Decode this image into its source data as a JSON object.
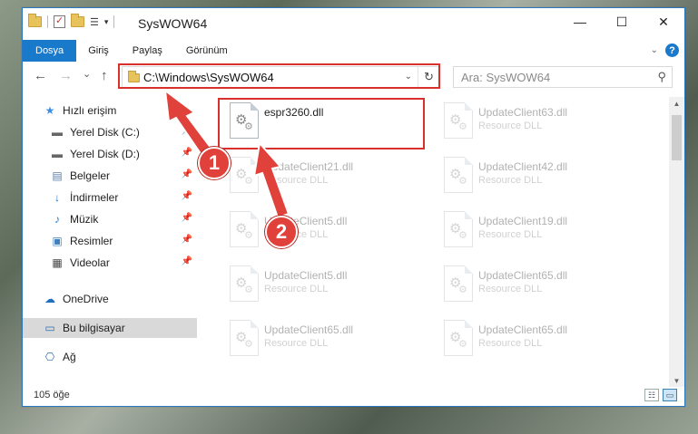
{
  "window": {
    "title": "SysWOW64",
    "controls": {
      "minimize": "—",
      "maximize": "☐",
      "close": "✕"
    }
  },
  "ribbon": {
    "tabs": [
      {
        "label": "Dosya",
        "active": true
      },
      {
        "label": "Giriş"
      },
      {
        "label": "Paylaş"
      },
      {
        "label": "Görünüm"
      }
    ],
    "help_label": "?"
  },
  "navigation": {
    "back": "←",
    "forward": "→",
    "recent": "⌄",
    "up": "↑",
    "address": "C:\\Windows\\SysWOW64",
    "refresh_icon": "↻",
    "search_placeholder": "Ara: SysWOW64"
  },
  "sidebar": {
    "items": [
      {
        "label": "Hızlı erişim",
        "icon": "star-icon",
        "pinned": false
      },
      {
        "label": "Yerel Disk (C:)",
        "icon": "drive-icon",
        "pinned": true
      },
      {
        "label": "Yerel Disk (D:)",
        "icon": "drive-icon",
        "pinned": true
      },
      {
        "label": "Belgeler",
        "icon": "documents-icon",
        "pinned": true
      },
      {
        "label": "İndirmeler",
        "icon": "downloads-icon",
        "pinned": true
      },
      {
        "label": "Müzik",
        "icon": "music-icon",
        "pinned": true
      },
      {
        "label": "Resimler",
        "icon": "pictures-icon",
        "pinned": true
      },
      {
        "label": "Videolar",
        "icon": "videos-icon",
        "pinned": true
      },
      {
        "label": "OneDrive",
        "icon": "cloud-icon",
        "pinned": false
      },
      {
        "label": "Bu bilgisayar",
        "icon": "computer-icon",
        "pinned": false,
        "selected": true
      },
      {
        "label": "Ağ",
        "icon": "network-icon",
        "pinned": false
      }
    ]
  },
  "files": [
    {
      "name": "espr3260.dll",
      "type": ""
    },
    {
      "name": "UpdateClient63.dll",
      "type": "Resource DLL"
    },
    {
      "name": "UpdateClient21.dll",
      "type": "Resource DLL"
    },
    {
      "name": "UpdateClient42.dll",
      "type": "Resource DLL"
    },
    {
      "name": "UpdateClient5.dll",
      "type": "Resource DLL"
    },
    {
      "name": "UpdateClient19.dll",
      "type": "Resource DLL"
    },
    {
      "name": "UpdateClient5.dll",
      "type": "Resource DLL"
    },
    {
      "name": "UpdateClient65.dll",
      "type": "Resource DLL"
    },
    {
      "name": "UpdateClient65.dll",
      "type": "Resource DLL"
    },
    {
      "name": "UpdateClient65.dll",
      "type": "Resource DLL"
    }
  ],
  "status": {
    "count": "105 öğe"
  },
  "annotations": {
    "step1": "1",
    "step2": "2",
    "color": "#e0413a"
  }
}
